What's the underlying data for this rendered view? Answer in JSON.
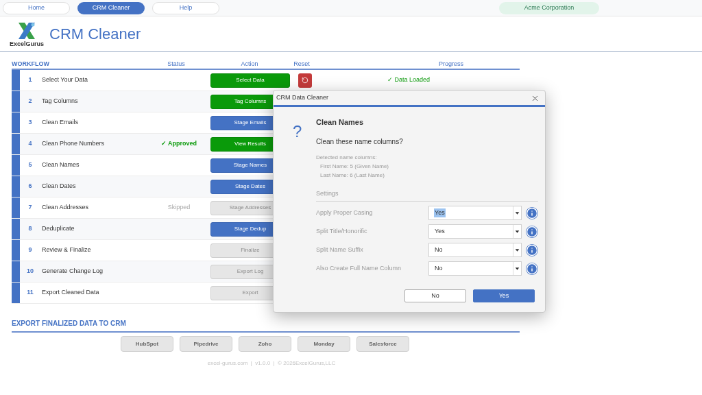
{
  "nav": {
    "tabs": [
      {
        "label": "Home",
        "selected": false
      },
      {
        "label": "CRM Cleaner",
        "selected": true
      },
      {
        "label": "Help",
        "selected": false
      }
    ],
    "company": "Acme Corporation"
  },
  "header": {
    "logo_text": "ExcelGurus",
    "title": "CRM Cleaner"
  },
  "workflow": {
    "heading": "WORKFLOW",
    "columns": [
      "Status",
      "Action",
      "Reset",
      "Progress"
    ],
    "rows": [
      {
        "number": "1",
        "label": "Select Your Data",
        "action": {
          "label": "Select Data",
          "kind": "done"
        },
        "reset": true,
        "progress": "✓ Data Loaded"
      },
      {
        "number": "2",
        "label": "Tag Columns",
        "action": {
          "label": "Tag Columns",
          "kind": "done"
        }
      },
      {
        "number": "3",
        "label": "Clean Emails",
        "action": {
          "label": "Stage Emails",
          "kind": "ready"
        }
      },
      {
        "number": "4",
        "label": "Clean Phone Numbers",
        "status": {
          "text": "✓ Approved",
          "kind": "approved"
        },
        "action": {
          "label": "View Results",
          "kind": "done"
        }
      },
      {
        "number": "5",
        "label": "Clean Names",
        "action": {
          "label": "Stage Names",
          "kind": "ready"
        }
      },
      {
        "number": "6",
        "label": "Clean Dates",
        "action": {
          "label": "Stage Dates",
          "kind": "ready"
        }
      },
      {
        "number": "7",
        "label": "Clean Addresses",
        "status": {
          "text": "Skipped",
          "kind": "skipped"
        },
        "action": {
          "label": "Stage Addresses",
          "kind": "disabled"
        }
      },
      {
        "number": "8",
        "label": "Deduplicate",
        "action": {
          "label": "Stage Dedup",
          "kind": "ready"
        }
      },
      {
        "number": "9",
        "label": "Review & Finalize",
        "action": {
          "label": "Finalize",
          "kind": "disabled"
        }
      },
      {
        "number": "10",
        "label": "Generate Change Log",
        "action": {
          "label": "Export Log",
          "kind": "disabled"
        }
      },
      {
        "number": "11",
        "label": "Export Cleaned Data",
        "action": {
          "label": "Export",
          "kind": "disabled"
        }
      }
    ]
  },
  "export": {
    "heading": "EXPORT FINALIZED DATA TO CRM",
    "buttons": [
      "HubSpot",
      "Pipedrive",
      "Zoho",
      "Monday",
      "Salesforce"
    ]
  },
  "footer": "excel-gurus.com  |  v1.0.0  |  © 2026ExcelGurus,LLC",
  "dialog": {
    "title": "CRM Data Cleaner",
    "icon": "?",
    "heading": "Clean Names",
    "question": "Clean these name columns?",
    "detected": {
      "label": "Detected name columns:",
      "items": [
        "First Name: 5 (Given Name)",
        "Last Name: 6 (Last Name)"
      ]
    },
    "settings_heading": "Settings",
    "settings": [
      {
        "label": "Apply Proper Casing",
        "value": "Yes",
        "selected": true
      },
      {
        "label": "Split Title/Honorific",
        "value": "Yes",
        "selected": false
      },
      {
        "label": "Split Name Suffix",
        "value": "No",
        "selected": false
      },
      {
        "label": "Also Create Full Name Column",
        "value": "No",
        "selected": false
      }
    ],
    "buttons": [
      {
        "label": "No",
        "kind": "secondary"
      },
      {
        "label": "Yes",
        "kind": "primary"
      }
    ]
  }
}
